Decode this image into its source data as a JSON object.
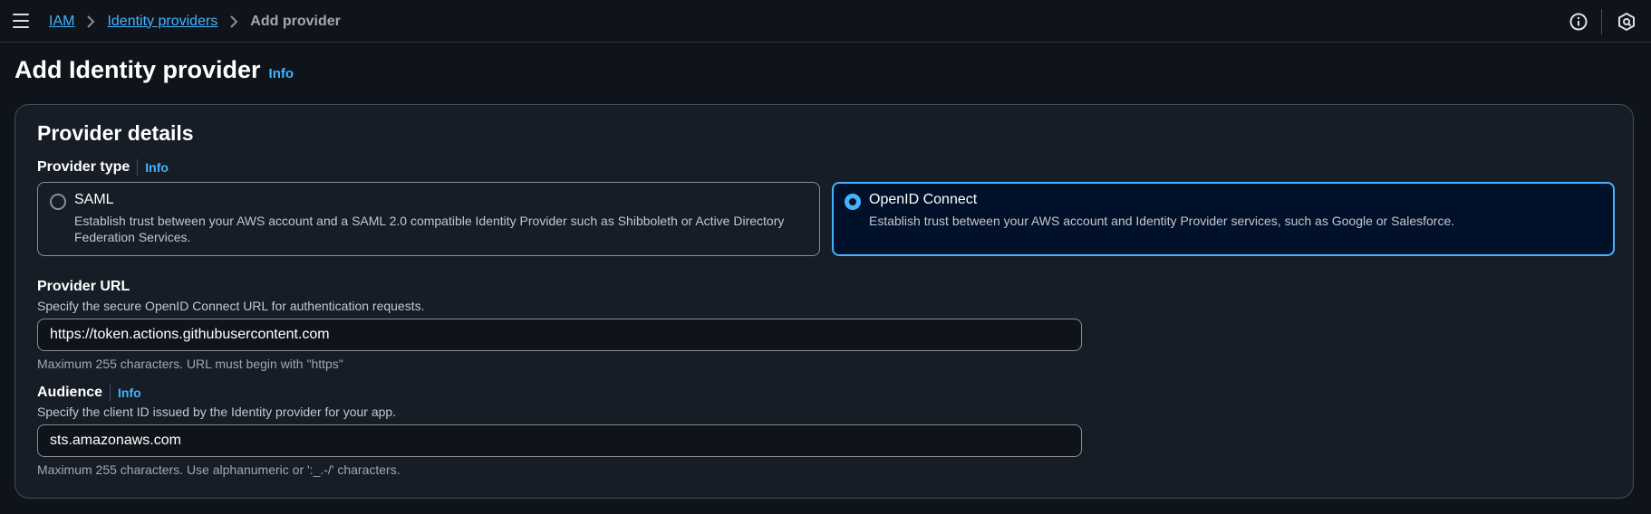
{
  "breadcrumb": {
    "items": [
      "IAM",
      "Identity providers"
    ],
    "current": "Add provider"
  },
  "header": {
    "title": "Add Identity provider",
    "info": "Info"
  },
  "panel": {
    "title": "Provider details",
    "provider_type": {
      "label": "Provider type",
      "info": "Info",
      "options": [
        {
          "title": "SAML",
          "description": "Establish trust between your AWS account and a SAML 2.0 compatible Identity Provider such as Shibboleth or Active Directory Federation Services.",
          "selected": false
        },
        {
          "title": "OpenID Connect",
          "description": "Establish trust between your AWS account and Identity Provider services, such as Google or Salesforce.",
          "selected": true
        }
      ]
    },
    "provider_url": {
      "label": "Provider URL",
      "description": "Specify the secure OpenID Connect URL for authentication requests.",
      "value": "https://token.actions.githubusercontent.com",
      "hint": "Maximum 255 characters. URL must begin with \"https\""
    },
    "audience": {
      "label": "Audience",
      "info": "Info",
      "description": "Specify the client ID issued by the Identity provider for your app.",
      "value": "sts.amazonaws.com",
      "hint": "Maximum 255 characters. Use alphanumeric or ':_.-/' characters."
    }
  },
  "icons": {
    "menu": "hamburger-menu-icon",
    "info": "info-circle-icon",
    "notifications": "hexagon-status-icon"
  },
  "colors": {
    "accent": "#42b4ff",
    "background": "#0f141a",
    "panel": "#161d26",
    "selected_tile": "#001129"
  }
}
